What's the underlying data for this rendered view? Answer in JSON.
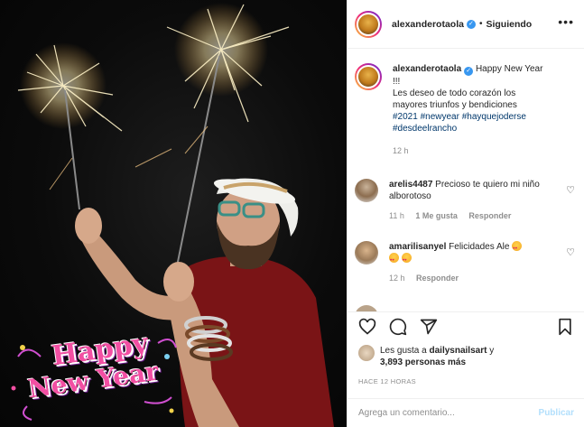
{
  "header": {
    "username": "alexanderotaola",
    "dot": "•",
    "follow_status": "Siguiendo",
    "more_icon": "more-horizontal-icon"
  },
  "photo": {
    "sticker_line1": "Happy",
    "sticker_line2": "New Year",
    "colors": {
      "sticker_pink": "#f24fa3",
      "sticker_white": "#ffffff",
      "shirt": "#7a1416",
      "background": "#0b0b0b"
    }
  },
  "caption": {
    "username": "alexanderotaola",
    "text_line1": "Happy New Year",
    "text_line2": "!!!",
    "text_line3": "Les deseo de todo corazón los",
    "text_line4": "mayores triunfos y bendiciones",
    "tags_line1": "#2021 #newyear #hayquejoderse",
    "tags_line2": "#desdeelrancho",
    "time": "12 h"
  },
  "comments": [
    {
      "username": "arelis4487",
      "text": "Precioso te quiero mi niño alborotoso",
      "time": "11 h",
      "likes": "1 Me gusta",
      "reply": "Responder"
    },
    {
      "username": "amarilisanyel",
      "text": "Felicidades Ale",
      "time": "12 h",
      "reply": "Responder"
    }
  ],
  "actions": {
    "like_icon": "heart-icon",
    "comment_icon": "comment-icon",
    "share_icon": "share-icon",
    "save_icon": "bookmark-icon",
    "likes_prefix": "Les gusta a",
    "likes_user": "dailysnailsart",
    "likes_conj": "y",
    "likes_others": "3,893 personas más",
    "time_ago": "HACE 12 HORAS"
  },
  "add_comment": {
    "placeholder": "Agrega un comentario...",
    "publish_label": "Publicar"
  },
  "colors": {
    "link": "#00376b",
    "verified": "#3897f0",
    "muted": "#8e8e8e",
    "publish_disabled": "#b2dffc"
  }
}
